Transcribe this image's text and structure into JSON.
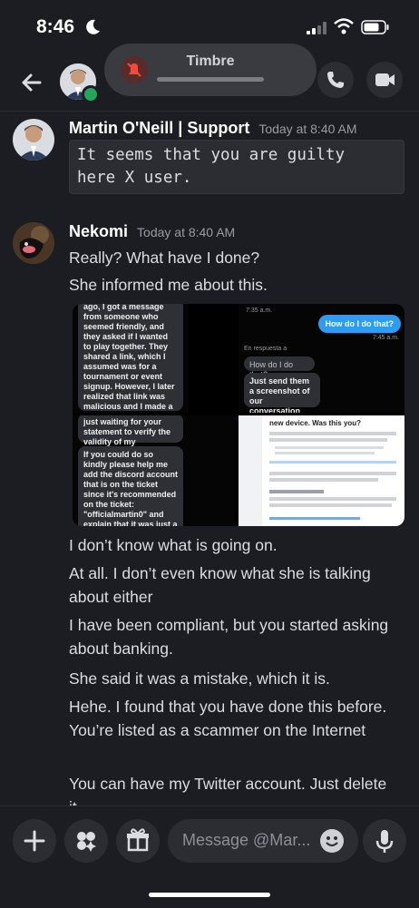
{
  "status_bar": {
    "time": "8:46"
  },
  "notification": {
    "title": "Timbre"
  },
  "chat": {
    "messages": [
      {
        "author": "Martin O'Neill | Support",
        "timestamp": "Today at 8:40 AM",
        "code_lines": [
          "It seems that you are guilty",
          "here X user."
        ]
      },
      {
        "author": "Nekomi",
        "timestamp": "Today at 8:40 AM",
        "lines_before": [
          "Really? What have I done?",
          "She informed me about this."
        ],
        "attachments": {
          "t1_text": "ago, I got a message from someone who seemed friendly, and they asked if I wanted to play together. They shared a link, which I assumed was for a tournament or event signup. However, I later realized that link was malicious and I made a mistake in trusting it. Unfortunately, in my panic, I thought it had something",
          "t2_time_top": "7:35 a.m.",
          "t2_question": "How do I do that?",
          "t2_time_right": "7:45 a.m.",
          "t2_reply_label": "En respuesta a",
          "t2_quote": "How do I do that?",
          "t2_answer": "Just send them a screenshot of our conversation",
          "t3_text_top": "just waiting for your statement to verify the validity of my statements.",
          "t3_text": "If you could do so kindly please help me add the discord account that is on the ticket since it's recommended on the ticket: \"officialmartin0\" and explain that it was just a false accusation and the",
          "t4_title": "new device. Was this you?"
        },
        "lines_after": [
          "I don’t know what is going on.",
          "At all. I don’t even know what she is talking about either",
          "I have been compliant, but you started asking about banking.",
          "She said it was a mistake, which it is.",
          "Hehe. I found that you have done this before. You’re listed as a scammer on the Internet",
          "You can have my Twitter account. Just delete it."
        ]
      }
    ]
  },
  "composer": {
    "placeholder": "Message @Mar..."
  },
  "colors": {
    "online": "#23a55a",
    "bubble_blue": "#2d9cf3",
    "background": "#1c1d23"
  }
}
